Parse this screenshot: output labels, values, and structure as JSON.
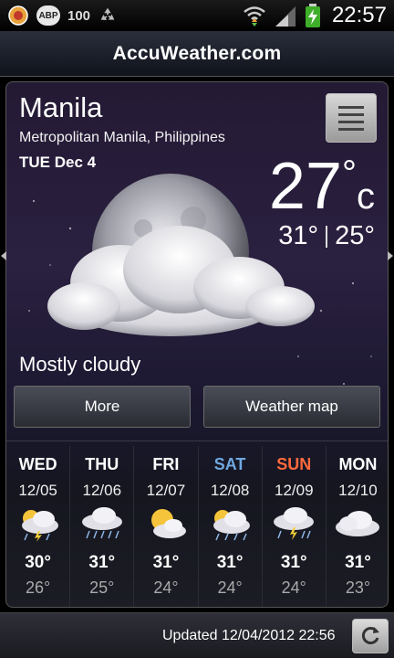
{
  "status_bar": {
    "left_icons": [
      "browser-icon",
      "abp-icon",
      "100-badge-icon",
      "recycle-icon"
    ],
    "abp_text": "ABP",
    "badge_text": "100",
    "right_icons": [
      "wifi-icon",
      "signal-icon",
      "battery-charging-icon"
    ],
    "time": "22:57"
  },
  "title_bar": {
    "brand": "AccuWeather.com"
  },
  "current": {
    "city": "Manila",
    "region": "Metropolitan Manila, Philippines",
    "date": "TUE Dec 4",
    "temp": "27",
    "temp_deg": "°",
    "temp_unit": "c",
    "high": "31°",
    "low": "25°",
    "condition": "Mostly cloudy",
    "icon": "moon-cloud-icon"
  },
  "buttons": {
    "more": "More",
    "weather_map": "Weather map"
  },
  "forecast": [
    {
      "day": "WED",
      "date": "12/05",
      "hi": "30°",
      "lo": "26°",
      "icon": "thunderstorm-icon",
      "color": "#ffffff"
    },
    {
      "day": "THU",
      "date": "12/06",
      "hi": "31°",
      "lo": "25°",
      "icon": "rain-cloud-icon",
      "color": "#ffffff"
    },
    {
      "day": "FRI",
      "date": "12/07",
      "hi": "31°",
      "lo": "24°",
      "icon": "partly-sunny-icon",
      "color": "#ffffff"
    },
    {
      "day": "SAT",
      "date": "12/08",
      "hi": "31°",
      "lo": "24°",
      "icon": "sun-rain-icon",
      "color": "#6fa8e0"
    },
    {
      "day": "SUN",
      "date": "12/09",
      "hi": "31°",
      "lo": "24°",
      "icon": "thunderstorm-icon",
      "color": "#ff6a3d"
    },
    {
      "day": "MON",
      "date": "12/10",
      "hi": "31°",
      "lo": "23°",
      "icon": "cloud-icon",
      "color": "#ffffff"
    }
  ],
  "footer": {
    "updated": "Updated 12/04/2012 22:56"
  }
}
